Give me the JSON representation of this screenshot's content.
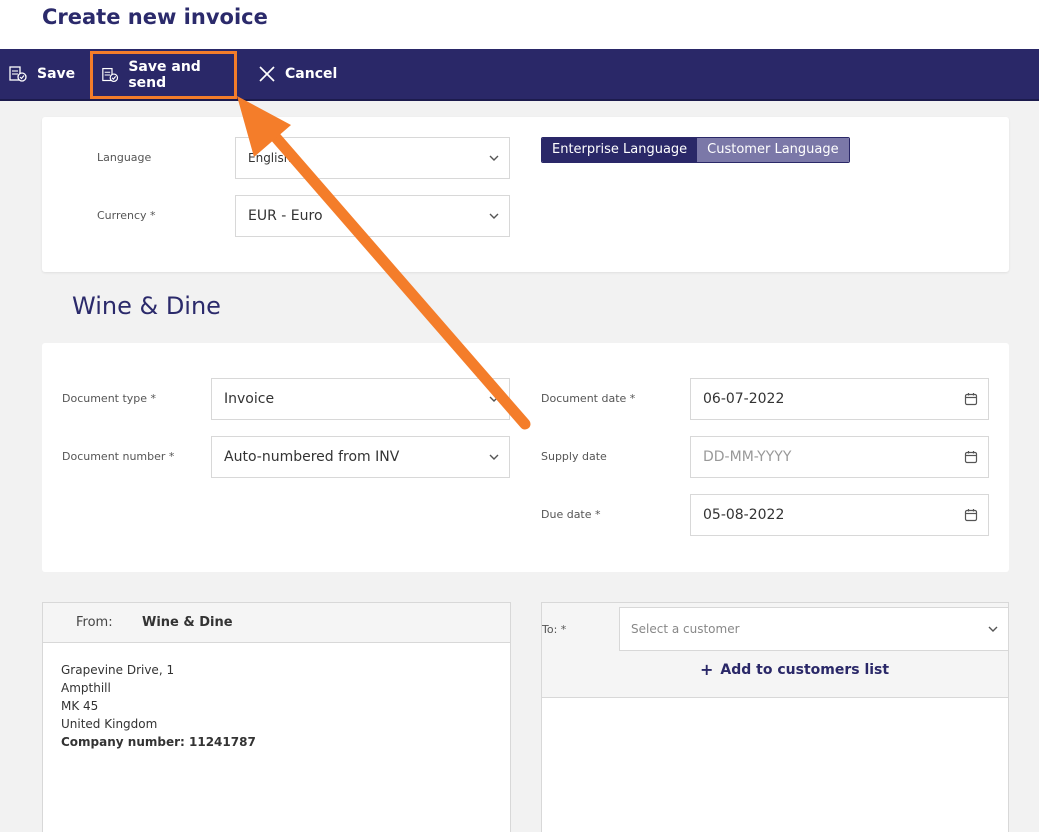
{
  "page": {
    "title": "Create new invoice"
  },
  "toolbar": {
    "save": "Save",
    "save_send": "Save and send",
    "cancel": "Cancel"
  },
  "language_card": {
    "language_label": "Language",
    "language_value": "English",
    "currency_label": "Currency *",
    "currency_value": "EUR - Euro",
    "toggle": {
      "enterprise": "Enterprise Language",
      "customer": "Customer Language",
      "active": "enterprise"
    }
  },
  "company": {
    "name": "Wine & Dine"
  },
  "document": {
    "type_label": "Document type *",
    "type_value": "Invoice",
    "number_label": "Document number *",
    "number_value": "Auto-numbered from INV",
    "date_label": "Document date *",
    "date_value": "06-07-2022",
    "supply_label": "Supply date",
    "supply_placeholder": "DD-MM-YYYY",
    "due_label": "Due date *",
    "due_value": "05-08-2022"
  },
  "from": {
    "label": "From:",
    "name": "Wine & Dine",
    "address_line1": "Grapevine Drive, 1",
    "address_line2": "Ampthill",
    "address_line3": "MK 45",
    "address_line4": "United Kingdom",
    "company_number": "Company number: 11241787"
  },
  "to": {
    "label": "To: *",
    "placeholder": "Select a customer",
    "add_label": "Add to customers list"
  },
  "colors": {
    "primary": "#2a2868",
    "highlight": "#f47d2a",
    "toggle_inactive": "#7b78a8"
  }
}
